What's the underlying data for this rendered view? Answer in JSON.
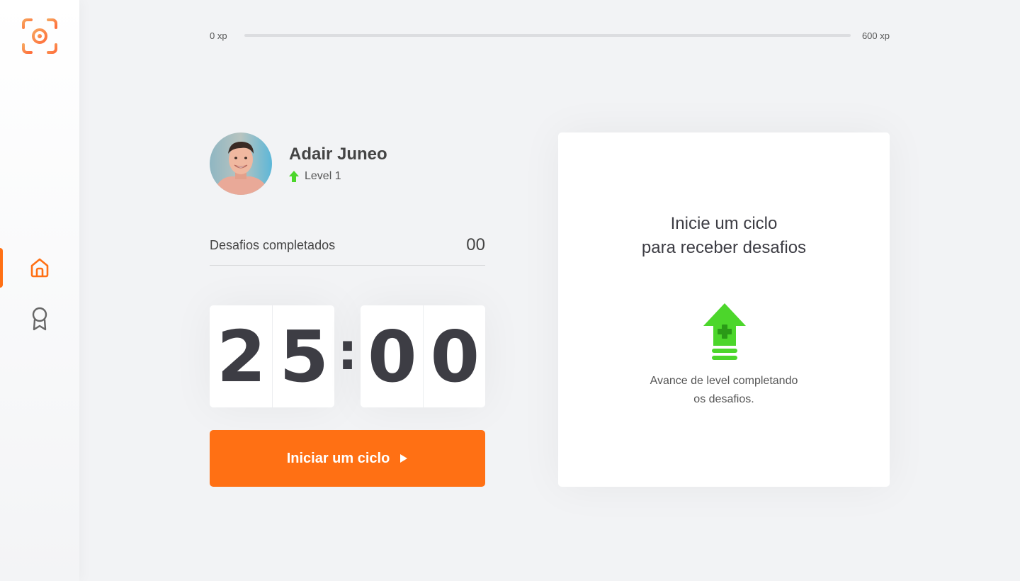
{
  "colors": {
    "accent": "#ff7014",
    "level_green": "#4cd62b",
    "text_dark": "#3d3d44",
    "background": "#f2f3f5",
    "card": "#ffffff"
  },
  "sidebar": {
    "logo_icon": "target-focus-icon",
    "items": [
      {
        "icon": "home-icon",
        "active": true
      },
      {
        "icon": "award-icon",
        "active": false
      }
    ]
  },
  "experience": {
    "min_label": "0 xp",
    "max_label": "600 xp",
    "progress_fraction": 0
  },
  "profile": {
    "name": "Adair Juneo",
    "level_label": "Level 1"
  },
  "challenges": {
    "label": "Desafios completados",
    "count": "00"
  },
  "countdown": {
    "minute_left": "2",
    "minute_right": "5",
    "separator": ":",
    "second_left": "0",
    "second_right": "0"
  },
  "start_button": {
    "label": "Iniciar um ciclo",
    "icon": "play-icon"
  },
  "challenge_card": {
    "title_line1": "Inicie um ciclo",
    "title_line2": "para receber desafios",
    "icon": "level-up-icon",
    "text_line1": "Avance de level completando",
    "text_line2": "os desafios."
  }
}
